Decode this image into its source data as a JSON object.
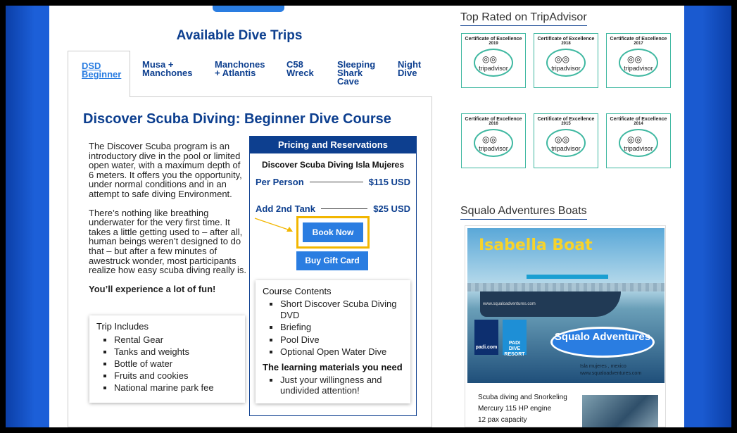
{
  "section_title": "Available Dive Trips",
  "tabs": [
    {
      "label": "DSD Beginner",
      "active": true
    },
    {
      "label": "Musa + Manchones"
    },
    {
      "label": "Manchones + Atlantis"
    },
    {
      "label": "C58 Wreck"
    },
    {
      "label": "Sleeping Shark Cave"
    },
    {
      "label": "Night Dive"
    }
  ],
  "course": {
    "title": "Discover Scuba Diving: Beginner Dive Course",
    "para1": "The Discover Scuba program is an introductory dive in the pool or limited open water, with a maximum depth of 6 meters. It offers you the opportunity, under normal conditions and in an attempt to safe diving Environment.",
    "para2": "There’s nothing like breathing underwater for the very first time. It takes a little getting used to – after all, human beings weren’t designed to do that – but after a few minutes of awestruck wonder, most participants realize how easy scuba diving really is.",
    "fun": "You’ll experience a lot of fun!"
  },
  "includes": {
    "title": "Trip Includes",
    "items": [
      "Rental Gear",
      "Tanks and weights",
      "Bottle of water",
      "Fruits and cookies",
      "National marine park fee"
    ]
  },
  "pricing": {
    "header": "Pricing and Reservations",
    "subtitle": "Discover Scuba Diving Isla Mujeres",
    "per_person_label": "Per Person",
    "per_person_price": "$115 USD",
    "tank_label": "Add 2nd Tank",
    "tank_price": "$25 USD",
    "book_label": "Book Now",
    "gift_label": "Buy Gift Card"
  },
  "contents": {
    "title": "Course Contents",
    "items": [
      "Short Discover Scuba Diving DVD",
      "Briefing",
      "Pool Dive",
      "Optional Open Water Dive"
    ],
    "materials_title": "The learning materials you need",
    "materials_items": [
      "Just your willingness and undivided attention!"
    ]
  },
  "tripadvisor": {
    "title": "Top Rated on TripAdvisor",
    "cert_label": "Certificate of Excellence",
    "logo_text": "tripadvisor",
    "years": [
      "2019",
      "2018",
      "2017",
      "2016",
      "2015",
      "2014"
    ]
  },
  "boats": {
    "title": "Squalo Adventures Boats",
    "boat_name": "Isabella Boat",
    "boat_hull_url": "www.squaloadventures.com",
    "padi_label": "PADI",
    "padi_url": "padi.com",
    "dive_resort": "DIVE RESORT",
    "logo": "Squalo Adventures",
    "logo_location": "Isla mujeres , mexico",
    "logo_url": "www.squaloadventures.com",
    "specs": [
      "Scuba diving and Snorkeling",
      "Mercury 115 HP engine",
      "12 pax capacity"
    ]
  },
  "colors": {
    "brand": "#0d3f8f",
    "accent": "#2a7de1",
    "highlight": "#f2b600",
    "tripadvisor": "#3fb8a1"
  }
}
